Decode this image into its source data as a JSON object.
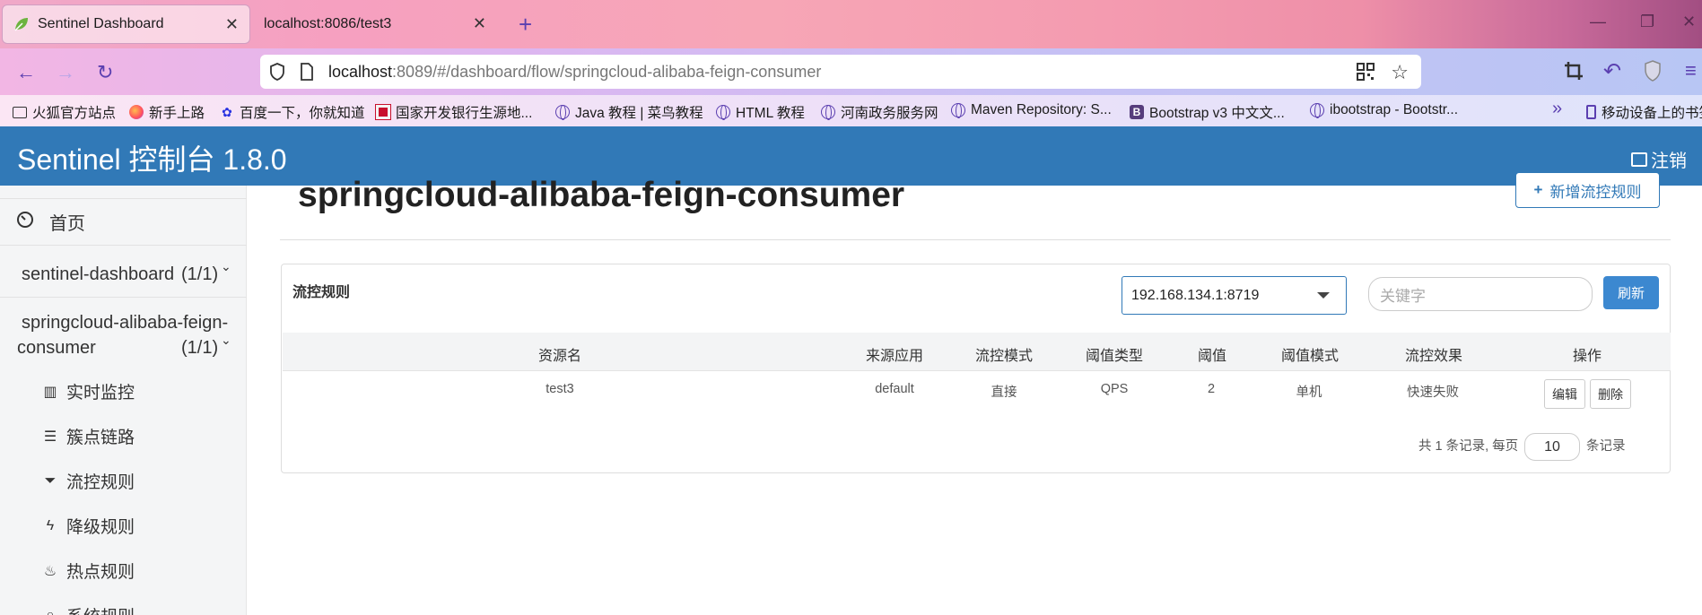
{
  "browser": {
    "tabs": [
      {
        "title": "Sentinel Dashboard",
        "active": true
      },
      {
        "title": "localhost:8086/test3",
        "active": false
      }
    ],
    "url_host": "localhost",
    "url_rest": ":8089/#/dashboard/flow/springcloud-alibaba-feign-consumer",
    "bookmarks": [
      "火狐官方站点",
      "新手上路",
      "百度一下，你就知道",
      "国家开发银行生源地...",
      "Java 教程 | 菜鸟教程",
      "HTML 教程",
      "河南政务服务网",
      "Maven Repository: S...",
      "Bootstrap v3 中文文...",
      "ibootstrap - Bootstr...",
      "移动设备上的书签"
    ]
  },
  "header": {
    "brand": "Sentinel 控制台 1.8.0",
    "logout": "注销"
  },
  "sidebar": {
    "home": "首页",
    "apps": [
      {
        "name": "sentinel-dashboard",
        "count": "(1/1)"
      },
      {
        "name_line1": "springcloud-alibaba-feign-",
        "name_line2": "consumer",
        "count": "(1/1)"
      }
    ],
    "submenu": [
      {
        "label": "实时监控",
        "icon": "bar-chart-icon"
      },
      {
        "label": "簇点链路",
        "icon": "list-icon"
      },
      {
        "label": "流控规则",
        "icon": "filter-icon"
      },
      {
        "label": "降级规则",
        "icon": "bolt-icon"
      },
      {
        "label": "热点规则",
        "icon": "fire-icon"
      },
      {
        "label": "系统规则",
        "icon": "lock-icon"
      }
    ]
  },
  "main": {
    "title": "springcloud-alibaba-feign-consumer",
    "add_rule": "新增流控规则",
    "panel_title": "流控规则",
    "machine": "192.168.134.1:8719",
    "search_placeholder": "关键字",
    "refresh": "刷新",
    "columns": [
      "资源名",
      "来源应用",
      "流控模式",
      "阈值类型",
      "阈值",
      "阈值模式",
      "流控效果",
      "操作"
    ],
    "rows": [
      {
        "resource": "test3",
        "origin": "default",
        "mode": "直接",
        "threshold_type": "QPS",
        "threshold": "2",
        "cluster_mode": "单机",
        "effect": "快速失败",
        "edit": "编辑",
        "delete": "删除"
      }
    ],
    "pager_prefix": "共 1 条记录, 每页",
    "page_size": "10",
    "pager_suffix": "条记录"
  }
}
